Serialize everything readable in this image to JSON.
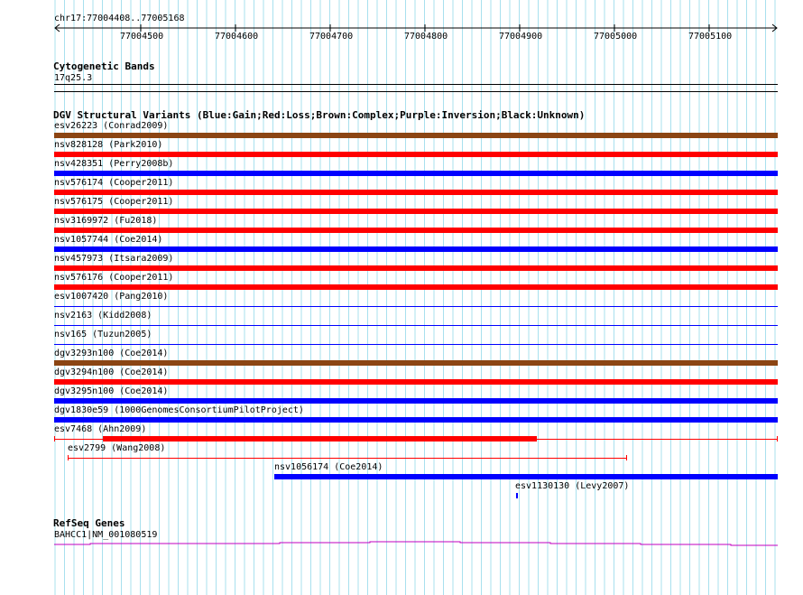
{
  "ruler": {
    "range_label": "chr17:77004408..77005168",
    "ticks": [
      "77004500",
      "77004600",
      "77004700",
      "77004800",
      "77004900",
      "77005000",
      "77005100"
    ]
  },
  "cyto": {
    "title": "Cytogenetic Bands",
    "band": "17q25.3"
  },
  "dgv": {
    "title": "DGV Structural Variants (Blue:Gain;Red:Loss;Brown:Complex;Purple:Inversion;Black:Unknown)",
    "colors": {
      "gain": "#0000ff",
      "loss": "#ff0000",
      "complex": "#8b4513",
      "unknown": "#000000"
    },
    "variants": [
      {
        "label": "esv26223 (Conrad2009)",
        "type": "complex",
        "style": "thick"
      },
      {
        "label": "nsv828128 (Park2010)",
        "type": "loss",
        "style": "thick"
      },
      {
        "label": "nsv428351 (Perry2008b)",
        "type": "gain",
        "style": "thick"
      },
      {
        "label": "nsv576174 (Cooper2011)",
        "type": "loss",
        "style": "thick"
      },
      {
        "label": "nsv576175 (Cooper2011)",
        "type": "loss",
        "style": "thick"
      },
      {
        "label": "nsv3169972 (Fu2018)",
        "type": "loss",
        "style": "thick"
      },
      {
        "label": "nsv1057744 (Coe2014)",
        "type": "gain",
        "style": "thick"
      },
      {
        "label": "nsv457973 (Itsara2009)",
        "type": "loss",
        "style": "thick"
      },
      {
        "label": "nsv576176 (Cooper2011)",
        "type": "loss",
        "style": "thick"
      },
      {
        "label": "esv1007420 (Pang2010)",
        "type": "gain",
        "style": "thin"
      },
      {
        "label": "nsv2163 (Kidd2008)",
        "type": "gain",
        "style": "thin"
      },
      {
        "label": "nsv165 (Tuzun2005)",
        "type": "gain",
        "style": "thin"
      },
      {
        "label": "dgv3293n100 (Coe2014)",
        "type": "complex",
        "style": "thick"
      },
      {
        "label": "dgv3294n100 (Coe2014)",
        "type": "loss",
        "style": "thick"
      },
      {
        "label": "dgv3295n100 (Coe2014)",
        "type": "gain",
        "style": "thick"
      },
      {
        "label": "dgv1830e59 (1000GenomesConsortiumPilotProject)",
        "type": "gain",
        "style": "thick"
      },
      {
        "label": "esv7468 (Ahn2009)",
        "type": "loss",
        "style": "inner"
      },
      {
        "label": "esv2799 (Wang2008)",
        "type": "loss",
        "style": "inner-thin"
      },
      {
        "label": "nsv1056174 (Coe2014)",
        "type": "gain",
        "style": "thick-partial"
      },
      {
        "label": "esv1130130 (Levy2007)",
        "type": "gain",
        "style": "tiny"
      }
    ]
  },
  "refseq": {
    "title": "RefSeq Genes",
    "gene": "BAHCC1|NM_001080519",
    "color": "#c000c0"
  }
}
